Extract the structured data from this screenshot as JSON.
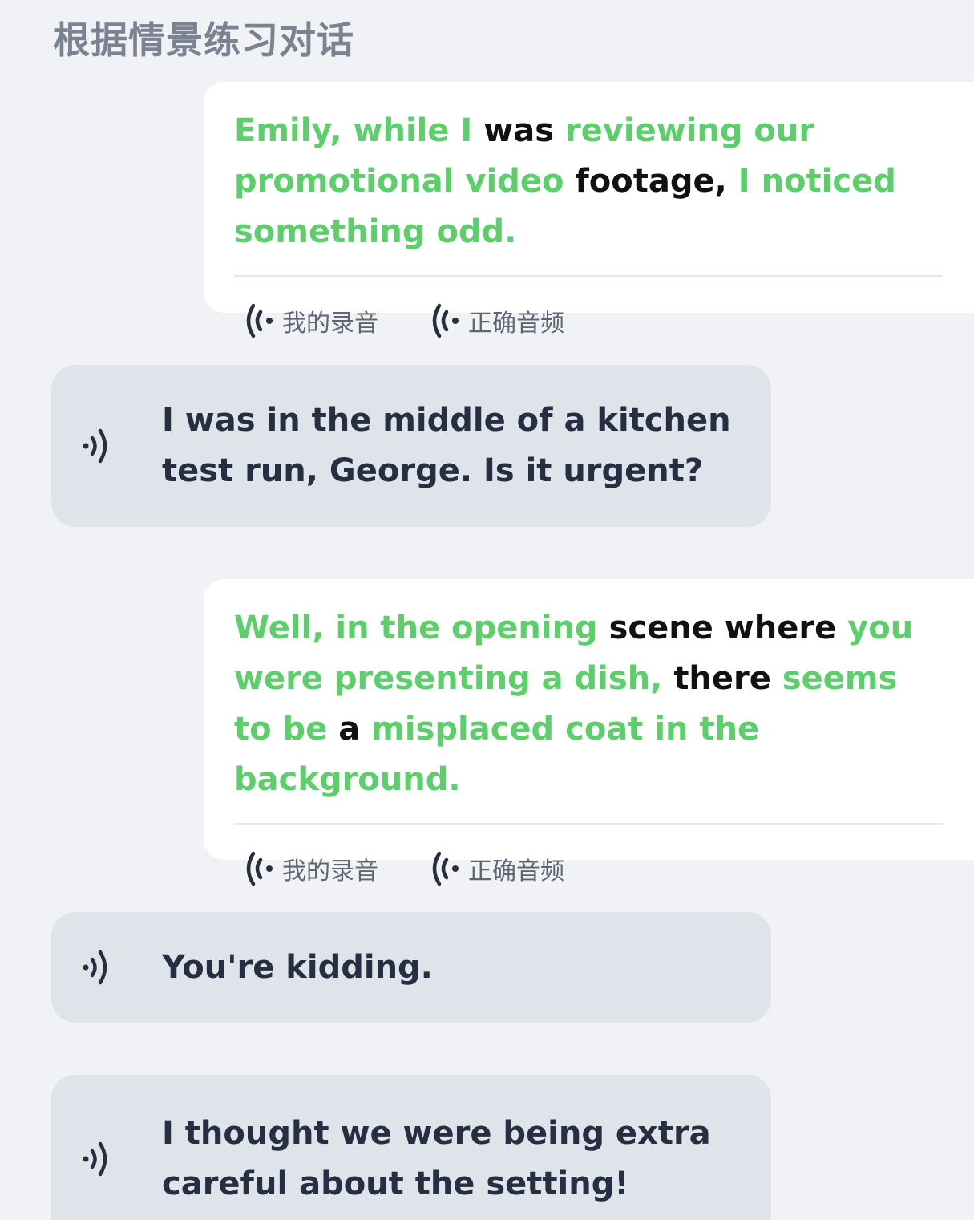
{
  "page": {
    "title": "根据情景练习对话"
  },
  "colors": {
    "correct_word": "#5ccf6b",
    "wrong_word": "#111111",
    "bot_text": "#262e42",
    "bot_bubble": "#dfe3ea",
    "user_bubble": "#ffffff",
    "background": "#f0f2f5"
  },
  "icons": {
    "user_action": "speaker-waves-icon",
    "bot_play": "sound-icon"
  },
  "messages": [
    {
      "role": "user",
      "words": [
        {
          "t": "Emily, while I",
          "ok": true
        },
        {
          "t": "was",
          "ok": false
        },
        {
          "t": "reviewing our promotional video",
          "ok": true
        },
        {
          "t": "footage,",
          "ok": false
        },
        {
          "t": "I noticed something odd.",
          "ok": true
        }
      ],
      "my_recording_label": "我的录音",
      "correct_audio_label": "正确音频"
    },
    {
      "role": "bot",
      "text": "I was in the middle of a kitchen test run, George. Is it urgent?"
    },
    {
      "role": "user",
      "words": [
        {
          "t": "Well, in the opening",
          "ok": true
        },
        {
          "t": "scene where",
          "ok": false
        },
        {
          "t": "you were presenting a dish,",
          "ok": true
        },
        {
          "t": "there",
          "ok": false
        },
        {
          "t": "seems to be",
          "ok": true
        },
        {
          "t": "a",
          "ok": false
        },
        {
          "t": "misplaced coat in the background.",
          "ok": true
        }
      ],
      "my_recording_label": "我的录音",
      "correct_audio_label": "正确音频"
    },
    {
      "role": "bot",
      "text": "You're kidding."
    },
    {
      "role": "bot",
      "text": "I thought we were being extra careful about the setting!"
    }
  ]
}
